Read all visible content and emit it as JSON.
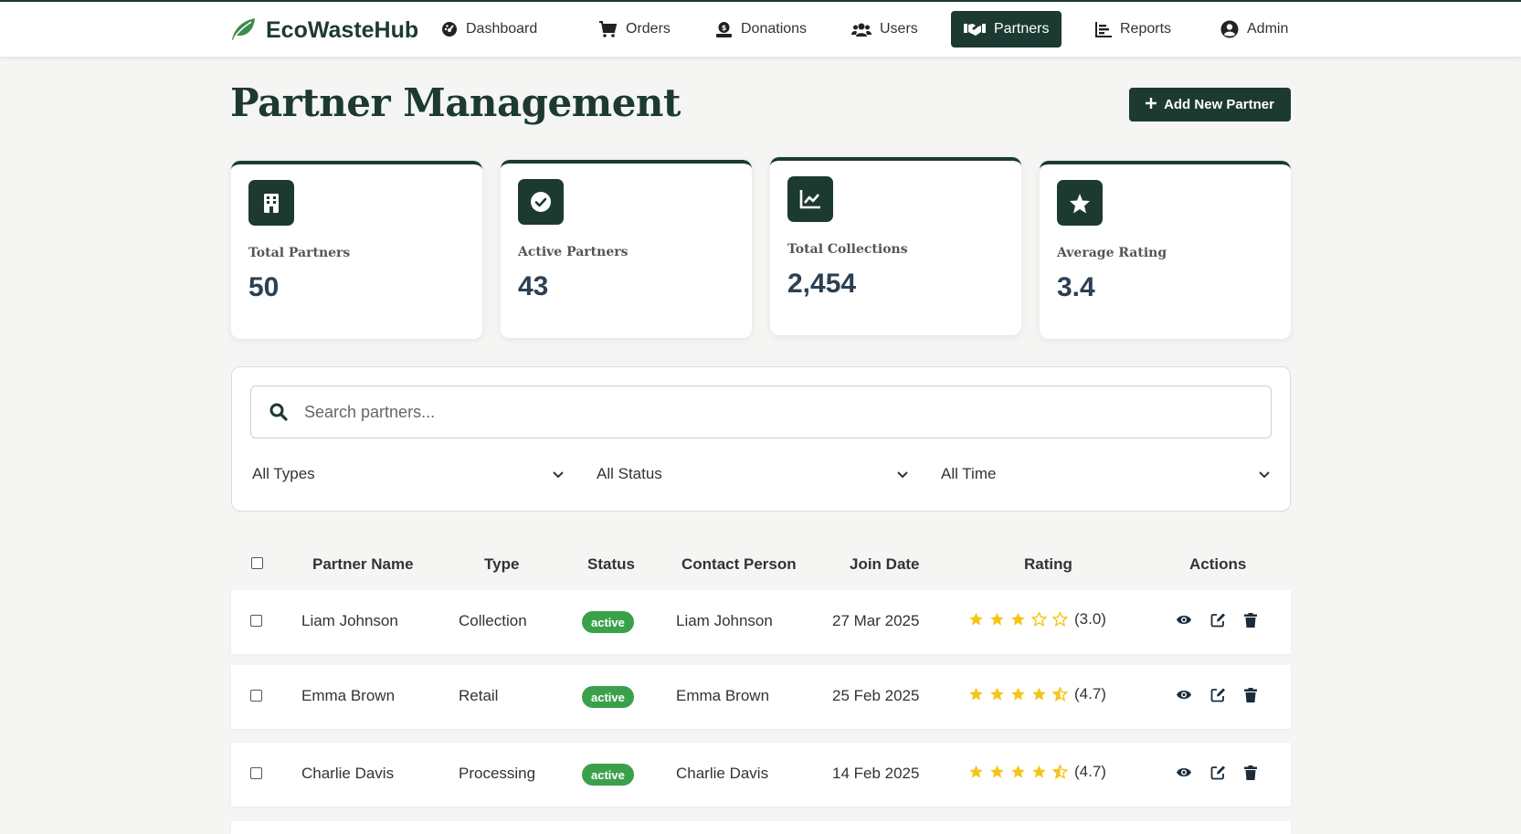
{
  "brand": {
    "name": "EcoWasteHub"
  },
  "nav": {
    "items": [
      {
        "label": "Dashboard"
      },
      {
        "label": "Orders"
      },
      {
        "label": "Donations"
      },
      {
        "label": "Users"
      },
      {
        "label": "Partners"
      },
      {
        "label": "Reports"
      }
    ],
    "user": {
      "label": "Admin"
    }
  },
  "page": {
    "title": "Partner Management",
    "add_button": "Add New Partner"
  },
  "stats": [
    {
      "label": "Total Partners",
      "value": "50",
      "icon": "building-icon"
    },
    {
      "label": "Active Partners",
      "value": "43",
      "icon": "check-circle-icon"
    },
    {
      "label": "Total Collections",
      "value": "2,454",
      "icon": "chart-line-icon"
    },
    {
      "label": "Average Rating",
      "value": "3.4",
      "icon": "star-icon"
    }
  ],
  "filters": {
    "search_placeholder": "Search partners...",
    "type": "All Types",
    "status": "All Status",
    "time": "All Time"
  },
  "table": {
    "headers": {
      "name": "Partner Name",
      "type": "Type",
      "status": "Status",
      "contact": "Contact Person",
      "join_date": "Join Date",
      "rating": "Rating",
      "actions": "Actions"
    },
    "rows": [
      {
        "name": "Liam Johnson",
        "type": "Collection",
        "status": "active",
        "contact": "Liam Johnson",
        "join_date": "27 Mar 2025",
        "rating": 3.0,
        "rating_text": "(3.0)"
      },
      {
        "name": "Emma Brown",
        "type": "Retail",
        "status": "active",
        "contact": "Emma Brown",
        "join_date": "25 Feb 2025",
        "rating": 4.7,
        "rating_text": "(4.7)"
      },
      {
        "name": "Charlie Davis",
        "type": "Processing",
        "status": "active",
        "contact": "Charlie Davis",
        "join_date": "14 Feb 2025",
        "rating": 4.7,
        "rating_text": "(4.7)"
      }
    ]
  },
  "colors": {
    "primary": "#1c3a32",
    "status_active": "#3aa14a",
    "star": "#f5c518",
    "leaf": "#3f8a4f"
  }
}
